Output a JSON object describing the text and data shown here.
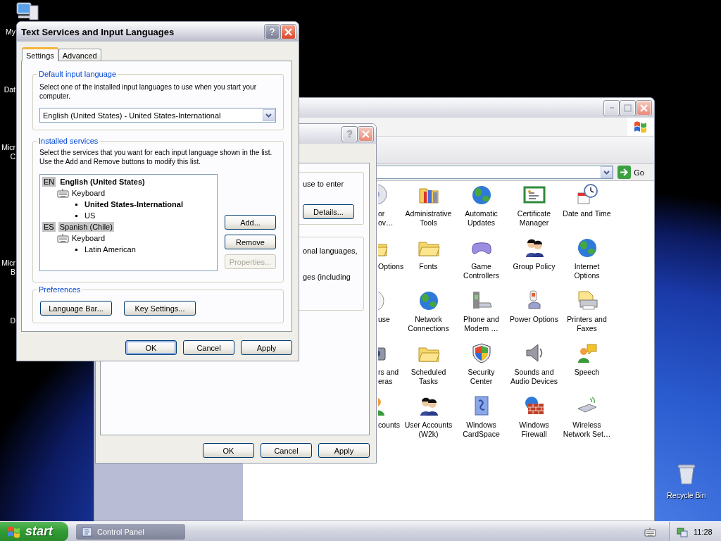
{
  "desktop": {
    "icons": [
      {
        "lines": [
          "My"
        ]
      },
      {
        "lines": [
          "Dat"
        ]
      },
      {
        "lines": [
          "Micr",
          "C"
        ]
      },
      {
        "lines": [
          "Micr",
          "B"
        ]
      },
      {
        "lines": [
          "D"
        ]
      }
    ],
    "recycle_bin": {
      "label": "Recycle Bin"
    }
  },
  "control_panel": {
    "go": "Go",
    "items": [
      {
        "lines": [
          "or",
          "ov…"
        ]
      },
      {
        "lines": [
          "Administrative",
          "Tools"
        ]
      },
      {
        "lines": [
          "Automatic",
          "Updates"
        ]
      },
      {
        "lines": [
          "Certificate",
          "Manager"
        ]
      },
      {
        "lines": [
          "Date and Time"
        ]
      },
      {
        "lines": [
          "Options"
        ]
      },
      {
        "lines": [
          "Fonts"
        ]
      },
      {
        "lines": [
          "Game",
          "Controllers"
        ]
      },
      {
        "lines": [
          "Group Policy"
        ]
      },
      {
        "lines": [
          "Internet",
          "Options"
        ]
      },
      {
        "lines": [
          "use"
        ]
      },
      {
        "lines": [
          "Network",
          "Connections"
        ]
      },
      {
        "lines": [
          "Phone and",
          "Modem …"
        ]
      },
      {
        "lines": [
          "Power Options"
        ]
      },
      {
        "lines": [
          "Printers and",
          "Faxes"
        ]
      },
      {
        "lines": [
          "rs and",
          "eras"
        ]
      },
      {
        "lines": [
          "Scheduled",
          "Tasks"
        ]
      },
      {
        "lines": [
          "Security",
          "Center"
        ]
      },
      {
        "lines": [
          "Sounds and",
          "Audio Devices"
        ]
      },
      {
        "lines": [
          "Speech"
        ]
      },
      {
        "lines": [
          "counts"
        ]
      },
      {
        "lines": [
          "User Accounts",
          "(W2k)"
        ]
      },
      {
        "lines": [
          "Windows",
          "CardSpace"
        ]
      },
      {
        "lines": [
          "Windows",
          "Firewall"
        ]
      },
      {
        "lines": [
          "Wireless",
          "Network Set…"
        ]
      }
    ]
  },
  "regional_dialog": {
    "help": "?",
    "groups": [
      {
        "lines": [
          "use to enter"
        ],
        "button": "Details..."
      },
      {
        "lines": [
          "onal languages,",
          "ges (including"
        ]
      }
    ],
    "buttons": [
      "OK",
      "Cancel",
      "Apply"
    ]
  },
  "text_services": {
    "title": "Text Services and Input Languages",
    "help": "?",
    "tabs": [
      {
        "label": "Settings",
        "selected": true
      },
      {
        "label": "Advanced",
        "selected": false
      }
    ],
    "default_group": {
      "label": "Default input language",
      "text": "Select one of the installed input languages to use when you start your computer.",
      "value": "English (United States) - United States-International"
    },
    "services_group": {
      "label": "Installed services",
      "text": "Select the services that you want for each input language shown in the list. Use the Add and Remove buttons to modify this list.",
      "tree": [
        {
          "code": "EN",
          "label": "English (United States)",
          "is_default": true,
          "selected": false,
          "children": [
            {
              "label": "Keyboard",
              "children": [
                {
                  "label": "United States-International",
                  "is_default": true
                },
                {
                  "label": "US",
                  "is_default": false
                }
              ]
            }
          ]
        },
        {
          "code": "ES",
          "label": "Spanish (Chile)",
          "is_default": false,
          "selected": true,
          "children": [
            {
              "label": "Keyboard",
              "children": [
                {
                  "label": "Latin American",
                  "is_default": false
                }
              ]
            }
          ]
        }
      ],
      "buttons": [
        {
          "label": "Add...",
          "disabled": false
        },
        {
          "label": "Remove",
          "disabled": false
        },
        {
          "label": "Properties...",
          "disabled": true
        }
      ]
    },
    "preferences_group": {
      "label": "Preferences",
      "buttons": [
        "Language Bar...",
        "Key Settings..."
      ]
    },
    "buttons": [
      {
        "label": "OK",
        "default": true
      },
      {
        "label": "Cancel",
        "default": false
      },
      {
        "label": "Apply",
        "default": false
      }
    ]
  },
  "taskbar": {
    "start": "start",
    "tasks": [
      {
        "label": "Control Panel",
        "selected": false
      }
    ],
    "clock": "11:28"
  }
}
